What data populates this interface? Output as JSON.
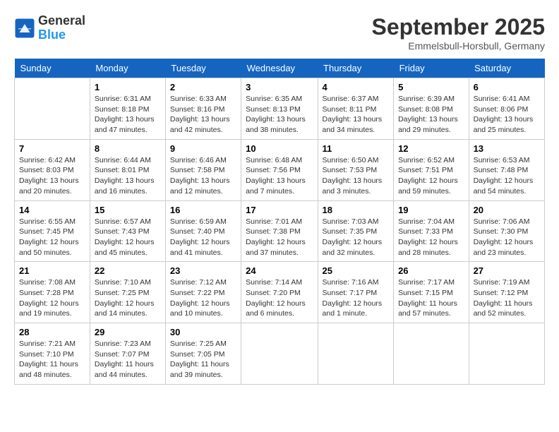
{
  "header": {
    "logo_general": "General",
    "logo_blue": "Blue",
    "month_title": "September 2025",
    "location": "Emmelsbull-Horsbull, Germany"
  },
  "weekdays": [
    "Sunday",
    "Monday",
    "Tuesday",
    "Wednesday",
    "Thursday",
    "Friday",
    "Saturday"
  ],
  "weeks": [
    [
      {
        "day": "",
        "info": ""
      },
      {
        "day": "1",
        "info": "Sunrise: 6:31 AM\nSunset: 8:18 PM\nDaylight: 13 hours\nand 47 minutes."
      },
      {
        "day": "2",
        "info": "Sunrise: 6:33 AM\nSunset: 8:16 PM\nDaylight: 13 hours\nand 42 minutes."
      },
      {
        "day": "3",
        "info": "Sunrise: 6:35 AM\nSunset: 8:13 PM\nDaylight: 13 hours\nand 38 minutes."
      },
      {
        "day": "4",
        "info": "Sunrise: 6:37 AM\nSunset: 8:11 PM\nDaylight: 13 hours\nand 34 minutes."
      },
      {
        "day": "5",
        "info": "Sunrise: 6:39 AM\nSunset: 8:08 PM\nDaylight: 13 hours\nand 29 minutes."
      },
      {
        "day": "6",
        "info": "Sunrise: 6:41 AM\nSunset: 8:06 PM\nDaylight: 13 hours\nand 25 minutes."
      }
    ],
    [
      {
        "day": "7",
        "info": "Sunrise: 6:42 AM\nSunset: 8:03 PM\nDaylight: 13 hours\nand 20 minutes."
      },
      {
        "day": "8",
        "info": "Sunrise: 6:44 AM\nSunset: 8:01 PM\nDaylight: 13 hours\nand 16 minutes."
      },
      {
        "day": "9",
        "info": "Sunrise: 6:46 AM\nSunset: 7:58 PM\nDaylight: 13 hours\nand 12 minutes."
      },
      {
        "day": "10",
        "info": "Sunrise: 6:48 AM\nSunset: 7:56 PM\nDaylight: 13 hours\nand 7 minutes."
      },
      {
        "day": "11",
        "info": "Sunrise: 6:50 AM\nSunset: 7:53 PM\nDaylight: 13 hours\nand 3 minutes."
      },
      {
        "day": "12",
        "info": "Sunrise: 6:52 AM\nSunset: 7:51 PM\nDaylight: 12 hours\nand 59 minutes."
      },
      {
        "day": "13",
        "info": "Sunrise: 6:53 AM\nSunset: 7:48 PM\nDaylight: 12 hours\nand 54 minutes."
      }
    ],
    [
      {
        "day": "14",
        "info": "Sunrise: 6:55 AM\nSunset: 7:45 PM\nDaylight: 12 hours\nand 50 minutes."
      },
      {
        "day": "15",
        "info": "Sunrise: 6:57 AM\nSunset: 7:43 PM\nDaylight: 12 hours\nand 45 minutes."
      },
      {
        "day": "16",
        "info": "Sunrise: 6:59 AM\nSunset: 7:40 PM\nDaylight: 12 hours\nand 41 minutes."
      },
      {
        "day": "17",
        "info": "Sunrise: 7:01 AM\nSunset: 7:38 PM\nDaylight: 12 hours\nand 37 minutes."
      },
      {
        "day": "18",
        "info": "Sunrise: 7:03 AM\nSunset: 7:35 PM\nDaylight: 12 hours\nand 32 minutes."
      },
      {
        "day": "19",
        "info": "Sunrise: 7:04 AM\nSunset: 7:33 PM\nDaylight: 12 hours\nand 28 minutes."
      },
      {
        "day": "20",
        "info": "Sunrise: 7:06 AM\nSunset: 7:30 PM\nDaylight: 12 hours\nand 23 minutes."
      }
    ],
    [
      {
        "day": "21",
        "info": "Sunrise: 7:08 AM\nSunset: 7:28 PM\nDaylight: 12 hours\nand 19 minutes."
      },
      {
        "day": "22",
        "info": "Sunrise: 7:10 AM\nSunset: 7:25 PM\nDaylight: 12 hours\nand 14 minutes."
      },
      {
        "day": "23",
        "info": "Sunrise: 7:12 AM\nSunset: 7:22 PM\nDaylight: 12 hours\nand 10 minutes."
      },
      {
        "day": "24",
        "info": "Sunrise: 7:14 AM\nSunset: 7:20 PM\nDaylight: 12 hours\nand 6 minutes."
      },
      {
        "day": "25",
        "info": "Sunrise: 7:16 AM\nSunset: 7:17 PM\nDaylight: 12 hours\nand 1 minute."
      },
      {
        "day": "26",
        "info": "Sunrise: 7:17 AM\nSunset: 7:15 PM\nDaylight: 11 hours\nand 57 minutes."
      },
      {
        "day": "27",
        "info": "Sunrise: 7:19 AM\nSunset: 7:12 PM\nDaylight: 11 hours\nand 52 minutes."
      }
    ],
    [
      {
        "day": "28",
        "info": "Sunrise: 7:21 AM\nSunset: 7:10 PM\nDaylight: 11 hours\nand 48 minutes."
      },
      {
        "day": "29",
        "info": "Sunrise: 7:23 AM\nSunset: 7:07 PM\nDaylight: 11 hours\nand 44 minutes."
      },
      {
        "day": "30",
        "info": "Sunrise: 7:25 AM\nSunset: 7:05 PM\nDaylight: 11 hours\nand 39 minutes."
      },
      {
        "day": "",
        "info": ""
      },
      {
        "day": "",
        "info": ""
      },
      {
        "day": "",
        "info": ""
      },
      {
        "day": "",
        "info": ""
      }
    ]
  ]
}
